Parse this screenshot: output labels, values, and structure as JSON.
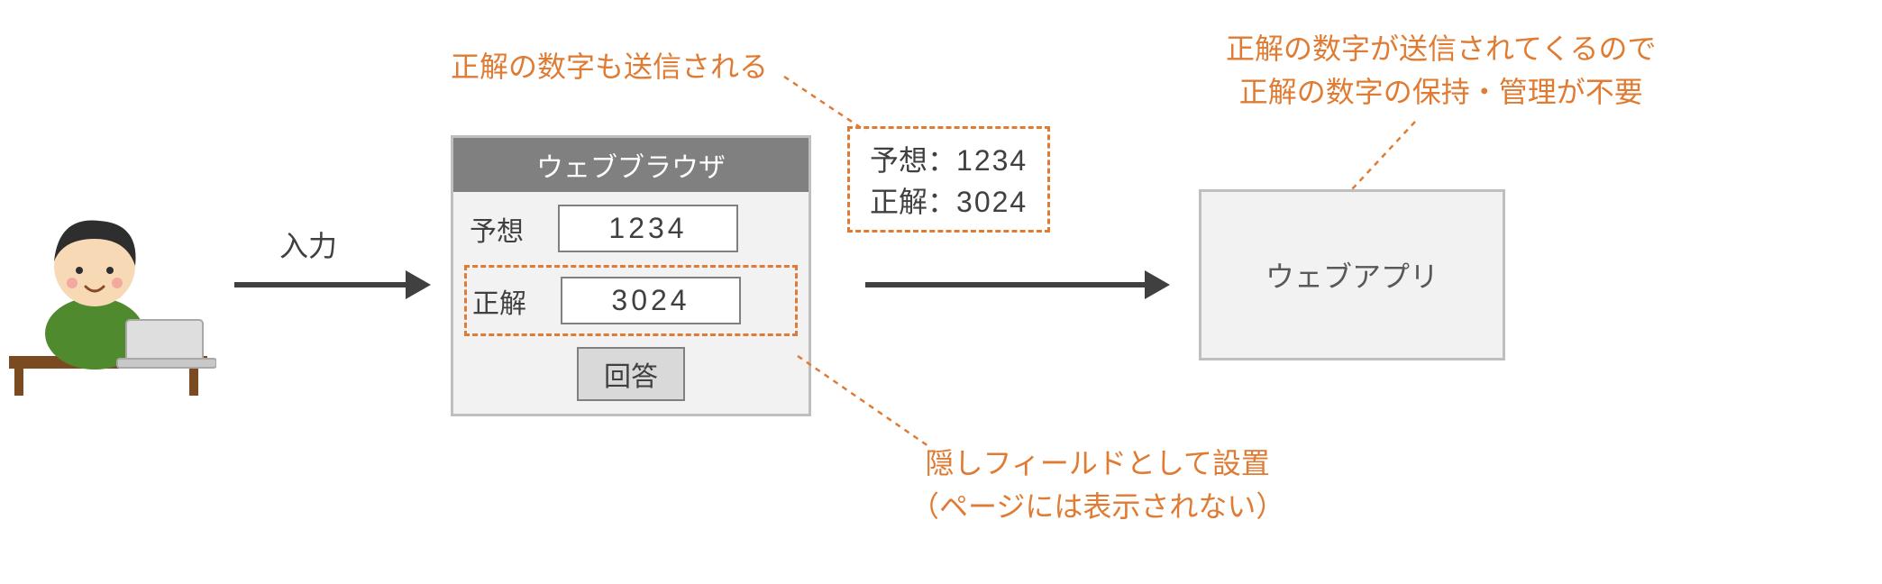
{
  "arrow1_label": "入力",
  "browser": {
    "title": "ウェブブラウザ",
    "guess_label": "予想",
    "guess_value": "1234",
    "answer_label": "正解",
    "answer_value": "3024",
    "submit_label": "回答"
  },
  "payload": {
    "guess_label": "予想：",
    "guess_value": "1234",
    "answer_label": "正解：",
    "answer_value": "3024"
  },
  "webapp_label": "ウェブアプリ",
  "anno_top_left": "正解の数字も送信される",
  "anno_top_right_line1": "正解の数字が送信されてくるので",
  "anno_top_right_line2": "正解の数字の保持・管理が不要",
  "anno_bottom_line1": "隠しフィールドとして設置",
  "anno_bottom_line2": "（ページには表示されない）"
}
